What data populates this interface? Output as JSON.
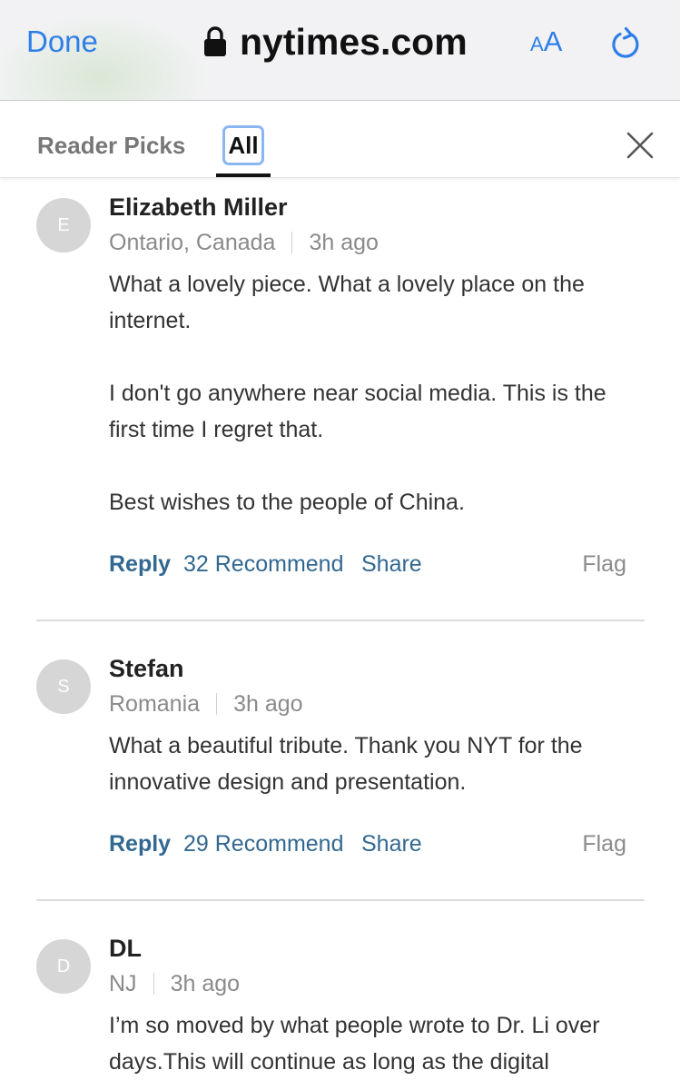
{
  "browser": {
    "done_label": "Done",
    "url": "nytimes.com",
    "text_size_small": "A",
    "text_size_large": "A",
    "accent_color": "#2f7ee8"
  },
  "tabs": {
    "reader_picks": "Reader Picks",
    "all": "All",
    "active": "All"
  },
  "comments": [
    {
      "avatar_letter": "E",
      "name": "Elizabeth Miller",
      "location": "Ontario, Canada",
      "time": "3h ago",
      "paragraphs": [
        "What a lovely piece. What a lovely place on the internet.",
        "I don't go anywhere near social media. This is the first time I regret that.",
        "Best wishes to the people of China."
      ],
      "reply": "Reply",
      "recommend": "32 Recommend",
      "share": "Share",
      "flag": "Flag"
    },
    {
      "avatar_letter": "S",
      "name": "Stefan",
      "location": "Romania",
      "time": "3h ago",
      "paragraphs": [
        "What a beautiful tribute. Thank you NYT for the innovative design and presentation."
      ],
      "reply": "Reply",
      "recommend": "29 Recommend",
      "share": "Share",
      "flag": "Flag"
    },
    {
      "avatar_letter": "D",
      "name": "DL",
      "location": "NJ",
      "time": "3h ago",
      "paragraphs": [
        "I’m so moved by what people wrote to Dr. Li over days.This will continue as long as the digital"
      ]
    }
  ]
}
